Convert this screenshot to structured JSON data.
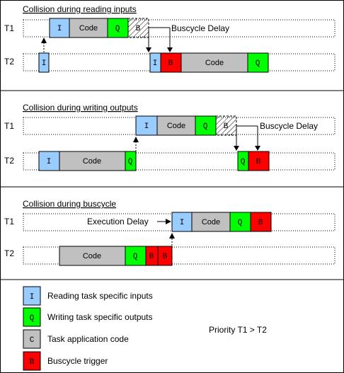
{
  "sections": [
    {
      "title": "Collision during reading inputs",
      "rows": [
        {
          "label": "T1",
          "blocks": [
            {
              "type": "I",
              "text": "I"
            },
            {
              "type": "C",
              "text": "Code"
            },
            {
              "type": "Q",
              "text": "Q"
            },
            {
              "type": "H",
              "text": "B"
            }
          ]
        },
        {
          "label": "T2",
          "blocks": [
            {
              "type": "I",
              "text": "I"
            },
            {
              "type": "I",
              "text": "I"
            },
            {
              "type": "B",
              "text": "B"
            },
            {
              "type": "C",
              "text": "Code"
            },
            {
              "type": "Q",
              "text": "Q"
            }
          ]
        }
      ],
      "delay_label": "Buscycle Delay"
    },
    {
      "title": "Collision during writing outputs",
      "rows": [
        {
          "label": "T1",
          "blocks": [
            {
              "type": "I",
              "text": "I"
            },
            {
              "type": "C",
              "text": "Code"
            },
            {
              "type": "Q",
              "text": "Q"
            },
            {
              "type": "H",
              "text": "B"
            }
          ]
        },
        {
          "label": "T2",
          "blocks": [
            {
              "type": "I",
              "text": "I"
            },
            {
              "type": "C",
              "text": "Code"
            },
            {
              "type": "Q",
              "text": "Q"
            },
            {
              "type": "Q",
              "text": "Q"
            },
            {
              "type": "B",
              "text": "B"
            }
          ]
        }
      ],
      "delay_label": "Buscycle Delay"
    },
    {
      "title": "Collision during buscycle",
      "rows": [
        {
          "label": "T1",
          "blocks": [
            {
              "type": "I",
              "text": "I"
            },
            {
              "type": "C",
              "text": "Code"
            },
            {
              "type": "Q",
              "text": "Q"
            },
            {
              "type": "B",
              "text": "B"
            }
          ]
        },
        {
          "label": "T2",
          "blocks": [
            {
              "type": "C",
              "text": "Code"
            },
            {
              "type": "Q",
              "text": "Q"
            },
            {
              "type": "B",
              "text": "B"
            },
            {
              "type": "B",
              "text": "B"
            }
          ]
        }
      ],
      "delay_label": "Execution Delay"
    }
  ],
  "legend": [
    {
      "type": "I",
      "symbol": "I",
      "text": "Reading task specific inputs"
    },
    {
      "type": "Q",
      "symbol": "Q",
      "text": "Writing task specific outputs"
    },
    {
      "type": "C",
      "symbol": "C",
      "text": "Task application code"
    },
    {
      "type": "B",
      "symbol": "B",
      "text": "Buscycle trigger"
    }
  ],
  "priority_note": "Priority T1 > T2",
  "colors": {
    "I": "#99ccff",
    "Q": "#00ff00",
    "C": "#c0c0c0",
    "B": "#ff0000",
    "H": "#ffffff"
  }
}
